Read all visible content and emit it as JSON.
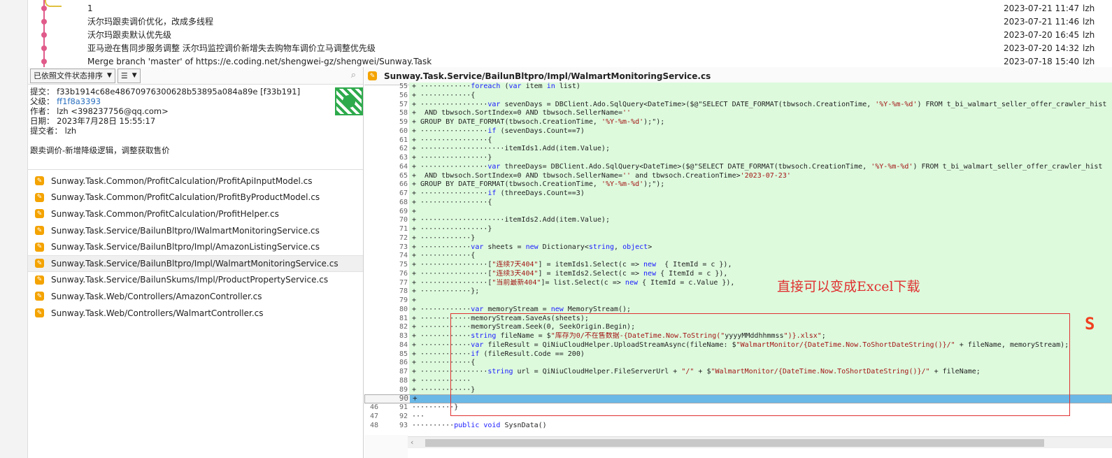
{
  "commits": [
    {
      "message": "1",
      "date": "2023-07-21 11:47",
      "author": "lzh"
    },
    {
      "message": "沃尔玛跟卖调价优化，改成多线程",
      "date": "2023-07-21 11:46",
      "author": "lzh"
    },
    {
      "message": "沃尔玛跟卖默认优先级",
      "date": "2023-07-20 16:45",
      "author": "lzh"
    },
    {
      "message": "亚马逊在售同步服务调整 沃尔玛监控调价新增失去购物车调价立马调整优先级",
      "date": "2023-07-20 14:32",
      "author": "lzh"
    },
    {
      "message": "Merge branch 'master' of https://e.coding.net/shengwei-gz/shengwei/Sunway.Task",
      "date": "2023-07-18 15:40",
      "author": "lzh"
    }
  ],
  "toolbar": {
    "sort_label": "已依照文件状态排序",
    "view_icon": "list-icon"
  },
  "commit_info": {
    "commit_label": "提交：",
    "commit_value": "f33b1914c68e48670976300628b53895a084a89e [f33b191]",
    "parent_label": "父级：",
    "parent_value": "ff1f8a3393",
    "author_label": "作者：",
    "author_value": "lzh <398237756@qq.com>",
    "date_label": "日期：",
    "date_value": "2023年7月28日 15:55:17",
    "committer_label": "提交者：",
    "committer_value": "lzh",
    "message": "跟卖调价-新增降级逻辑，调整获取售价"
  },
  "files": [
    "Sunway.Task.Common/ProfitCalculation/ProfitApiInputModel.cs",
    "Sunway.Task.Common/ProfitCalculation/ProfitByProductModel.cs",
    "Sunway.Task.Common/ProfitCalculation/ProfitHelper.cs",
    "Sunway.Task.Service/BailunBltpro/IWalmartMonitoringService.cs",
    "Sunway.Task.Service/BailunBltpro/Impl/AmazonListingService.cs",
    "Sunway.Task.Service/BailunBltpro/Impl/WalmartMonitoringService.cs",
    "Sunway.Task.Service/BailunSkums/Impl/ProductPropertyService.cs",
    "Sunway.Task.Web/Controllers/AmazonController.cs",
    "Sunway.Task.Web/Controllers/WalmartController.cs"
  ],
  "diff_header": "Sunway.Task.Service/BailunBltpro/Impl/WalmartMonitoringService.cs",
  "diff_lines": [
    {
      "old": "",
      "new": "55",
      "text": "+ ············foreach (var item in list)"
    },
    {
      "old": "",
      "new": "56",
      "text": "+ ············{"
    },
    {
      "old": "",
      "new": "57",
      "text": "+ ················var sevenDays = DBClient.Ado.SqlQuery<DateTime>($@\"SELECT DATE_FORMAT(tbwsoch.CreationTime, '%Y-%m-%d') FROM t_bi_walmart_seller_offer_crawler_hist"
    },
    {
      "old": "",
      "new": "58",
      "text": "+  AND tbwsoch.SortIndex=0 AND tbwsoch.SellerName=''"
    },
    {
      "old": "",
      "new": "59",
      "text": "+ GROUP BY DATE_FORMAT(tbwsoch.CreationTime, '%Y-%m-%d');\");"
    },
    {
      "old": "",
      "new": "60",
      "text": "+ ················if (sevenDays.Count==7)"
    },
    {
      "old": "",
      "new": "61",
      "text": "+ ················{"
    },
    {
      "old": "",
      "new": "62",
      "text": "+ ····················itemIds1.Add(item.Value);"
    },
    {
      "old": "",
      "new": "63",
      "text": "+ ················}"
    },
    {
      "old": "",
      "new": "64",
      "text": "+ ················var threeDays= DBClient.Ado.SqlQuery<DateTime>($@\"SELECT DATE_FORMAT(tbwsoch.CreationTime, '%Y-%m-%d') FROM t_bi_walmart_seller_offer_crawler_hist"
    },
    {
      "old": "",
      "new": "65",
      "text": "+  AND tbwsoch.SortIndex=0 AND tbwsoch.SellerName='' and tbwsoch.CreationTime>'2023-07-23'"
    },
    {
      "old": "",
      "new": "66",
      "text": "+ GROUP BY DATE_FORMAT(tbwsoch.CreationTime, '%Y-%m-%d');\");"
    },
    {
      "old": "",
      "new": "67",
      "text": "+ ················if (threeDays.Count==3)"
    },
    {
      "old": "",
      "new": "68",
      "text": "+ ················{"
    },
    {
      "old": "",
      "new": "69",
      "text": "+"
    },
    {
      "old": "",
      "new": "70",
      "text": "+ ····················itemIds2.Add(item.Value);"
    },
    {
      "old": "",
      "new": "71",
      "text": "+ ················}"
    },
    {
      "old": "",
      "new": "72",
      "text": "+ ············}"
    },
    {
      "old": "",
      "new": "73",
      "text": "+ ············var sheets = new Dictionary<string, object>"
    },
    {
      "old": "",
      "new": "74",
      "text": "+ ············{"
    },
    {
      "old": "",
      "new": "75",
      "text": "+ ················[\"连续7天404\"] = itemIds1.Select(c => new  { ItemId = c }),"
    },
    {
      "old": "",
      "new": "76",
      "text": "+ ················[\"连续3天404\"] = itemIds2.Select(c => new { ItemId = c }),"
    },
    {
      "old": "",
      "new": "77",
      "text": "+ ················[\"当前最新404\"]= list.Select(c => new { ItemId = c.Value }),"
    },
    {
      "old": "",
      "new": "78",
      "text": "+ ············};"
    },
    {
      "old": "",
      "new": "79",
      "text": "+"
    },
    {
      "old": "",
      "new": "80",
      "text": "+ ············var memoryStream = new MemoryStream();"
    },
    {
      "old": "",
      "new": "81",
      "text": "+ ············memoryStream.SaveAs(sheets);"
    },
    {
      "old": "",
      "new": "82",
      "text": "+ ············memoryStream.Seek(0, SeekOrigin.Begin);"
    },
    {
      "old": "",
      "new": "83",
      "text": "+ ············string fileName = $\"库存为0/不在售数据-{DateTime.Now.ToString(\"yyyyMMddhhmmss\")}.xlsx\";"
    },
    {
      "old": "",
      "new": "84",
      "text": "+ ············var fileResult = QiNiuCloudHelper.UploadStreamAsync(fileName: $\"WalmartMonitor/{DateTime.Now.ToShortDateString()}/\" + fileName, memoryStream);"
    },
    {
      "old": "",
      "new": "85",
      "text": "+ ············if (fileResult.Code == 200)"
    },
    {
      "old": "",
      "new": "86",
      "text": "+ ············{"
    },
    {
      "old": "",
      "new": "87",
      "text": "+ ················string url = QiNiuCloudHelper.FileServerUrl + \"/\" + $\"WalmartMonitor/{DateTime.Now.ToShortDateString()}/\" + fileName;"
    },
    {
      "old": "",
      "new": "88",
      "text": "+ ············"
    },
    {
      "old": "",
      "new": "89",
      "text": "+ ············}"
    },
    {
      "old": "",
      "new": "90",
      "text": "+"
    },
    {
      "old": "46",
      "new": "91",
      "text": "··········}"
    },
    {
      "old": "47",
      "new": "92",
      "text": "···"
    },
    {
      "old": "48",
      "new": "93",
      "text": "··········public void SysnData()"
    }
  ],
  "annotation": "直接可以变成Excel下载",
  "logo_glyph": "S"
}
